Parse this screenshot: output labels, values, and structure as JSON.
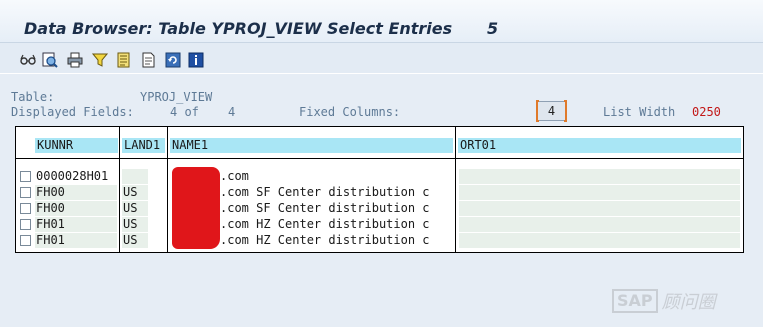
{
  "window": {
    "title": "Data Browser: Table YPROJ_VIEW Select Entries",
    "entries_count": "5"
  },
  "toolbar": {
    "buttons": [
      {
        "icon": "glasses-icon"
      },
      {
        "icon": "details-icon"
      },
      {
        "icon": "printer-icon"
      },
      {
        "icon": "filter-icon"
      },
      {
        "icon": "sort-icon"
      },
      {
        "icon": "document-icon"
      },
      {
        "icon": "refresh-icon"
      },
      {
        "icon": "info-icon"
      }
    ]
  },
  "info": {
    "table_label": "Table:",
    "table_value": "YPROJ_VIEW",
    "displayed_fields_label": "Displayed Fields:",
    "displayed_fields_value": "4 of",
    "displayed_fields_total": "4",
    "fixed_columns_label": "Fixed Columns:",
    "fixed_columns_value": "4",
    "list_width_label": "List Width",
    "list_width_value": "0250"
  },
  "grid": {
    "columns": [
      "KUNNR",
      "LAND1",
      "NAME1",
      "ORT01"
    ],
    "rows": [
      {
        "kunnr": "0000028H01",
        "land1": "",
        "name1": ".com",
        "ort01": ""
      },
      {
        "kunnr": "FH00",
        "land1": "US",
        "name1": ".com SF Center distribution c",
        "ort01": ""
      },
      {
        "kunnr": "FH00",
        "land1": "US",
        "name1": ".com SF Center distribution c",
        "ort01": ""
      },
      {
        "kunnr": "FH01",
        "land1": "US",
        "name1": ".com HZ Center distribution c",
        "ort01": ""
      },
      {
        "kunnr": "FH01",
        "land1": "US",
        "name1": ".com HZ Center distribution c",
        "ort01": ""
      }
    ]
  },
  "watermark": {
    "brand": "SAP",
    "suffix": "顾问圈"
  },
  "colors": {
    "header_bg": "#a9e6f5",
    "redaction": "#e0161a",
    "list_width_value": "#c21818"
  }
}
